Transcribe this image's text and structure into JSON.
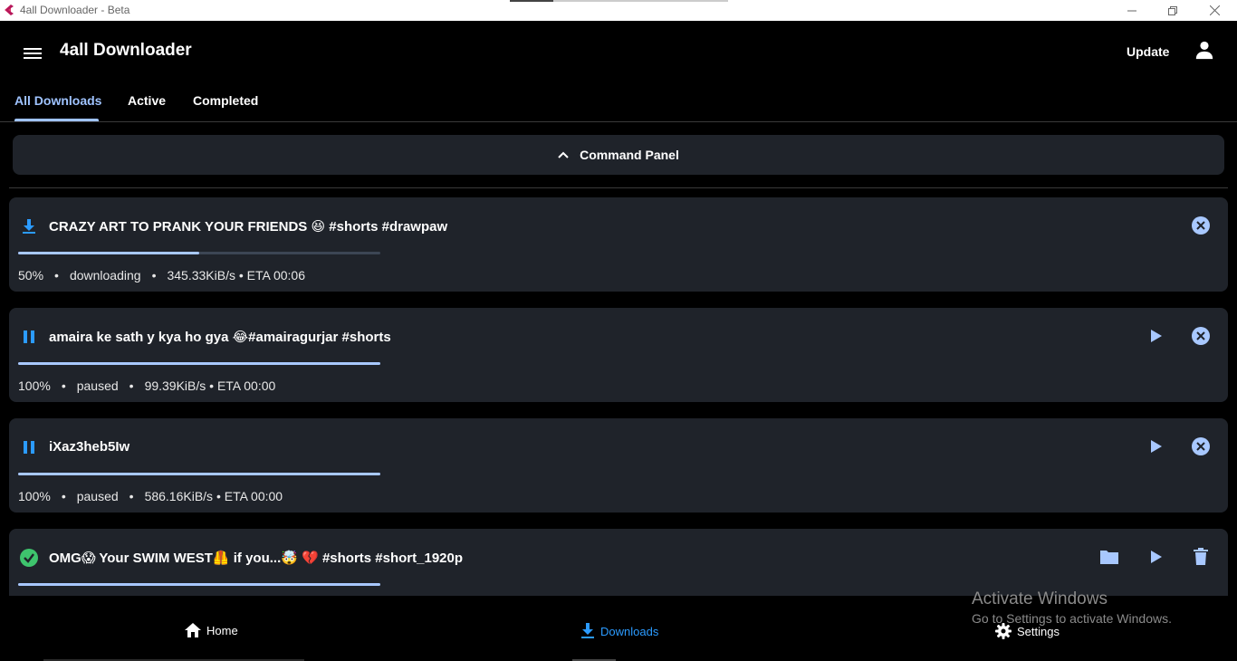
{
  "window": {
    "title": "4all Downloader - Beta",
    "controls": [
      "minimize",
      "restore",
      "close"
    ]
  },
  "appbar": {
    "menu_icon": "menu-icon",
    "title": "4all Downloader",
    "update_label": "Update",
    "account_icon": "account-icon"
  },
  "tabs": [
    {
      "label": "All Downloads",
      "active": true
    },
    {
      "label": "Active",
      "active": false
    },
    {
      "label": "Completed",
      "active": false
    }
  ],
  "command_panel": {
    "label": "Command Panel",
    "icon": "chevron-up-icon"
  },
  "downloads": [
    {
      "title": "CRAZY ART TO PRANK YOUR FRIENDS 😆 #shorts #drawpaw",
      "status_icon": "download-icon",
      "progress": 0.5,
      "percent": "50%",
      "state": "downloading",
      "rate_eta": "345.33KiB/s • ETA 00:06",
      "actions": [
        "cancel"
      ]
    },
    {
      "title": "amaira ke sath y kya ho gya 😂#amairagurjar #shorts",
      "status_icon": "pause-icon",
      "progress": 1.0,
      "percent": "100%",
      "state": "paused",
      "rate_eta": "99.39KiB/s • ETA 00:00",
      "actions": [
        "resume",
        "cancel"
      ]
    },
    {
      "title": "iXaz3heb5Iw",
      "status_icon": "pause-icon",
      "progress": 1.0,
      "percent": "100%",
      "state": "paused",
      "rate_eta": "586.16KiB/s • ETA 00:00",
      "actions": [
        "resume",
        "cancel"
      ]
    },
    {
      "title": "OMG😱 Your SWIM WEST🦺 if you...🤯 💔 #shorts #short_1920p",
      "status_icon": "check-circle-icon",
      "progress": 1.0,
      "actions": [
        "open-folder",
        "play",
        "delete"
      ]
    }
  ],
  "bottom_nav": [
    {
      "label": "Home",
      "icon": "home-icon",
      "active": false
    },
    {
      "label": "Downloads",
      "icon": "download-icon",
      "active": true
    },
    {
      "label": "Settings",
      "icon": "gear-icon",
      "active": false
    }
  ],
  "watermark": {
    "title": "Activate Windows",
    "subtitle": "Go to Settings to activate Windows."
  },
  "colors": {
    "accent": "#9fc3ff",
    "status_blue": "#2b9bff",
    "success_green": "#3ec46d",
    "card_bg": "#1f232a"
  },
  "dot": "•"
}
